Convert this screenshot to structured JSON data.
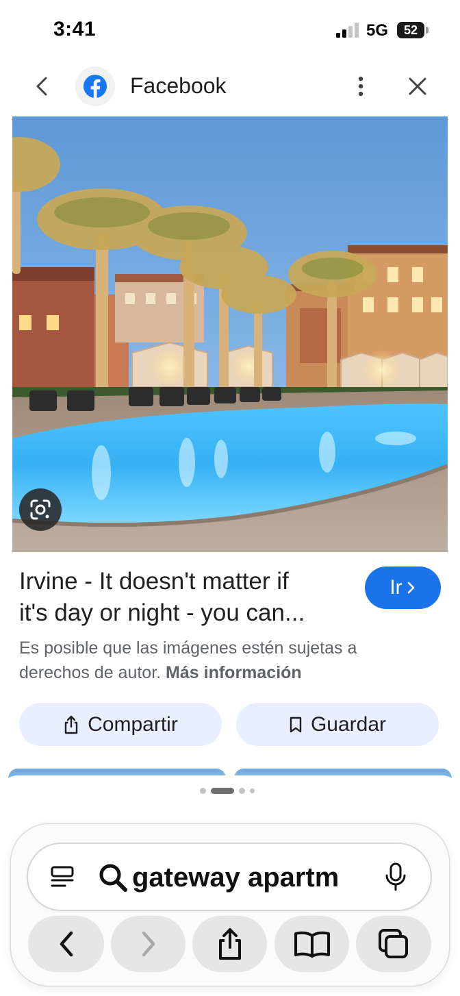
{
  "status_bar": {
    "time": "3:41",
    "network": "5G",
    "battery": "52"
  },
  "header": {
    "title": "Facebook",
    "back_icon": "chevron-left-icon",
    "logo": "facebook-logo",
    "more_icon": "more-vertical-icon",
    "close_icon": "close-icon"
  },
  "photo": {
    "lens_icon": "google-lens-icon"
  },
  "result": {
    "title_line1": "Irvine - It doesn't matter if",
    "title_line2": "it's day or night - you can...",
    "go_button": "Ir",
    "copyright_text": "Es posible que las imágenes estén sujetas a derechos de autor.",
    "more_info_link": "Más información"
  },
  "actions": {
    "share_label": "Compartir",
    "save_label": "Guardar"
  },
  "browser": {
    "address_text": "gateway apartm",
    "nav": [
      "back",
      "forward",
      "share",
      "bookmarks",
      "tabs"
    ]
  },
  "colors": {
    "accent_blue": "#1a73e8",
    "facebook_blue": "#1877f2",
    "chip_background": "#e8efff",
    "toolbar_button": "#e6e6e6"
  }
}
